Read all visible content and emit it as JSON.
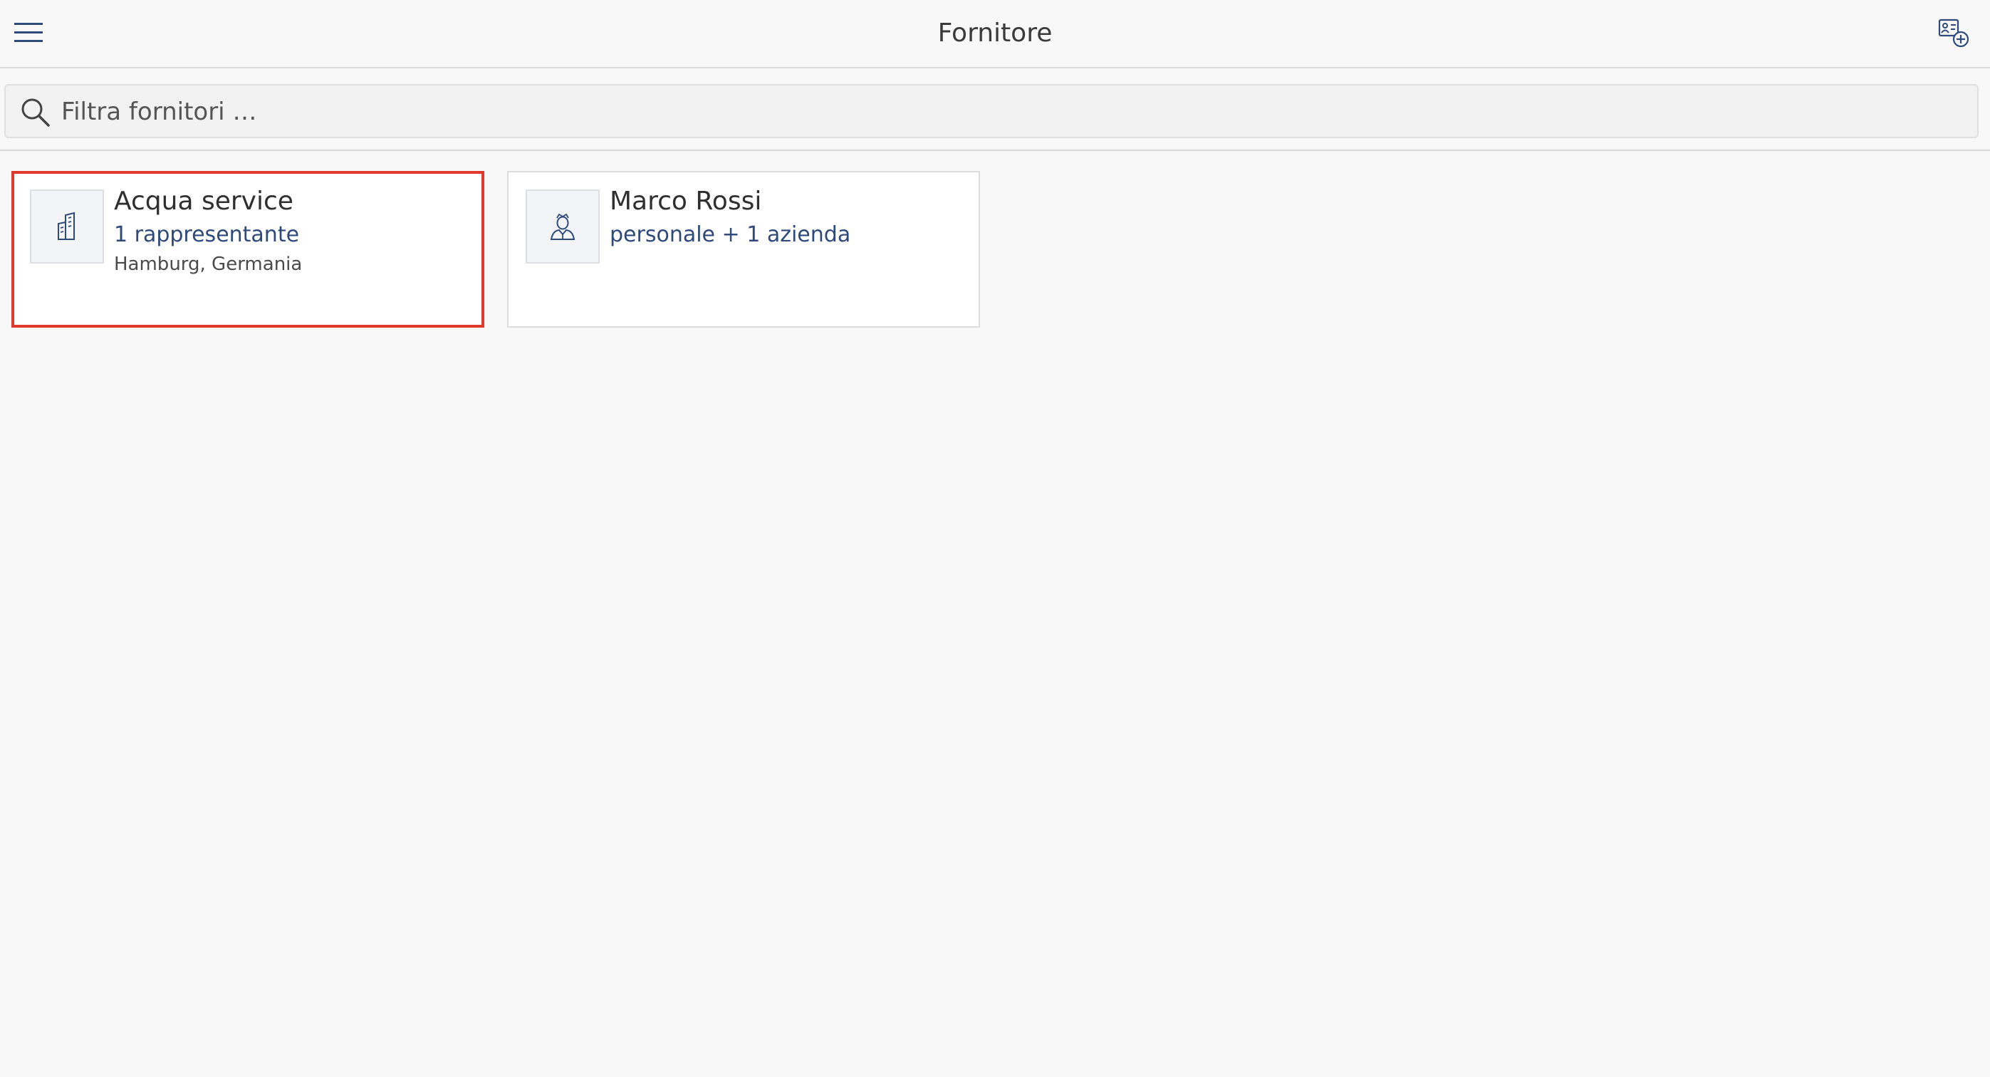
{
  "header": {
    "title": "Fornitore",
    "menu_icon": "hamburger-menu-icon",
    "add_icon": "add-contact-icon"
  },
  "search": {
    "placeholder": "Filtra fornitori …",
    "value": "",
    "icon": "search-icon"
  },
  "suppliers": [
    {
      "name": "Acqua service",
      "subtitle": "1 rappresentante",
      "location": "Hamburg, Germania",
      "icon": "building-icon",
      "selected": true
    },
    {
      "name": "Marco Rossi",
      "subtitle": "personale + 1 azienda",
      "location": "",
      "icon": "person-icon",
      "selected": false
    }
  ],
  "colors": {
    "accent": "#2e4a7a",
    "selection": "#e03a2e",
    "background": "#f8f8f8"
  }
}
